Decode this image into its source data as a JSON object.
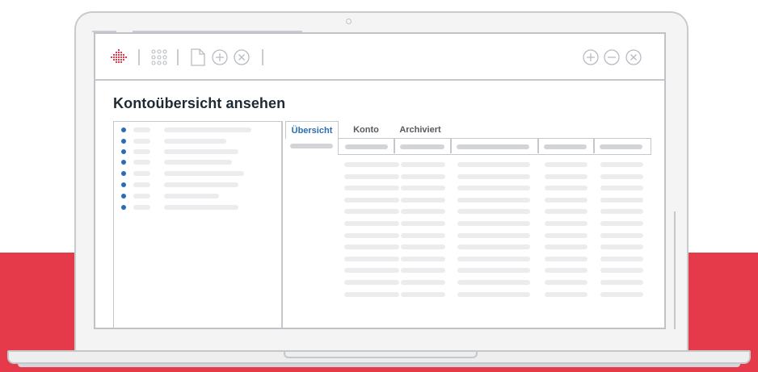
{
  "page": {
    "title": "Kontoübersicht ansehen"
  },
  "tabs": [
    {
      "label": "Übersicht",
      "active": true
    },
    {
      "label": "Konto",
      "active": false
    },
    {
      "label": "Archiviert",
      "active": false
    }
  ],
  "toolbar": {
    "left_icons": [
      "logo-icon",
      "grid-icon",
      "document-icon",
      "plus-circle-icon",
      "close-circle-icon"
    ],
    "right_icons": [
      "plus-circle-icon",
      "minus-circle-icon",
      "close-circle-icon"
    ]
  },
  "list": {
    "item_count": 8
  },
  "table": {
    "column_count": 6,
    "row_count": 12
  },
  "colors": {
    "accent": "#2a6db5",
    "brand_red": "#e43a4a"
  }
}
